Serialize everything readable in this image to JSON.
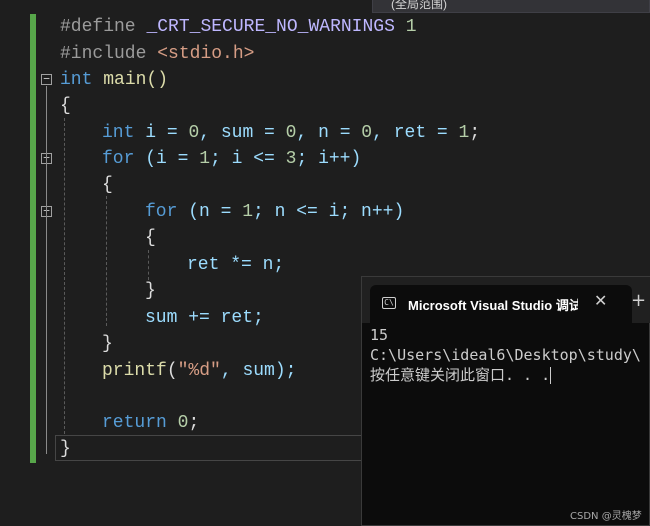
{
  "toolbar": {
    "scope_label": "(全局范围)"
  },
  "code": {
    "l1_define": "#define",
    "l1_macro": "_CRT_SECURE_NO_WARNINGS",
    "l1_val": "1",
    "l2_include": "#include",
    "l2_header": "<stdio.h>",
    "l3_int": "int",
    "l3_main": "main()",
    "brace_open": "{",
    "brace_close": "}",
    "l5_int": "int",
    "l5_rest_a": "i = ",
    "l5_zero1": "0",
    "l5_rest_b": ", sum = ",
    "l5_zero2": "0",
    "l5_rest_c": ", n = ",
    "l5_zero3": "0",
    "l5_rest_d": ", ret = ",
    "l5_one": "1",
    "l5_end": ";",
    "l6_for": "for",
    "l6_a": " (i = ",
    "l6_one": "1",
    "l6_b": "; i <= ",
    "l6_three": "3",
    "l6_c": "; i++)",
    "l8_for": "for",
    "l8_a": " (n = ",
    "l8_one": "1",
    "l8_b": "; n <= i; n++)",
    "l10_stmt": "ret *= n;",
    "l12_stmt": "sum += ret;",
    "l14_printf": "printf",
    "l14_open": "(",
    "l14_str": "\"%d\"",
    "l14_rest": ", sum);",
    "l16_return": "return",
    "l16_zero": "0",
    "l16_end": ";"
  },
  "fold_symbol": "−",
  "terminal": {
    "title": "Microsoft Visual Studio 调试控制台",
    "icon_glyph": "C\\",
    "close_glyph": "✕",
    "plus_glyph": "+",
    "output_line1": "15",
    "output_line2": "C:\\Users\\ideal6\\Desktop\\study\\",
    "output_line3": "按任意键关闭此窗口. . ."
  },
  "watermark": "CSDN @灵槐梦"
}
